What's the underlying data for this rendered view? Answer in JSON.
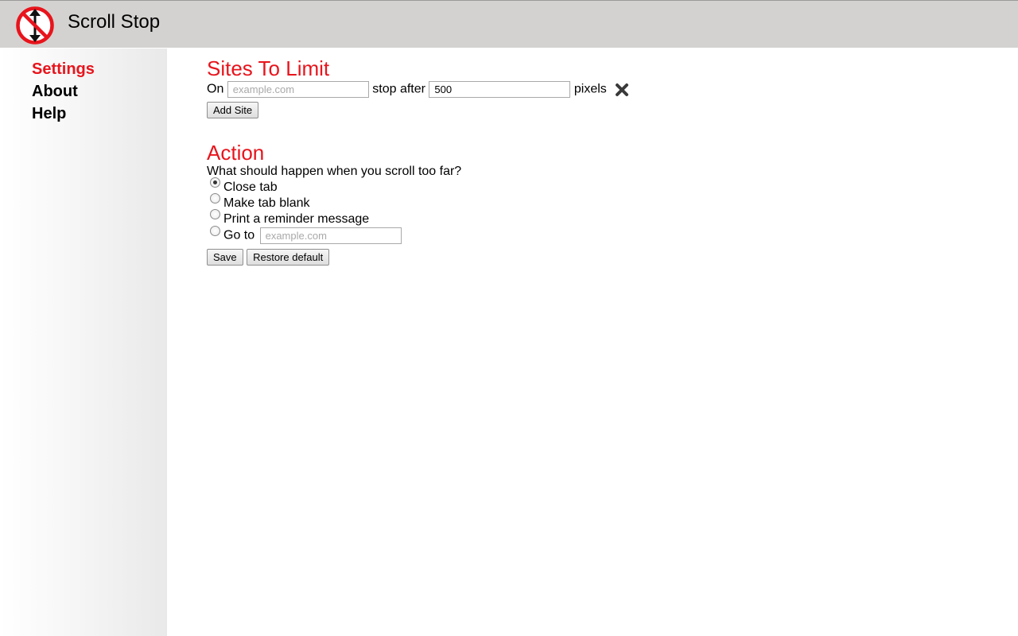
{
  "app": {
    "title": "Scroll Stop",
    "logo_icon": "no-scroll-icon",
    "accent_color": "#e8141c"
  },
  "sidebar": {
    "items": [
      {
        "label": "Settings",
        "active": true
      },
      {
        "label": "About",
        "active": false
      },
      {
        "label": "Help",
        "active": false
      }
    ]
  },
  "sites_section": {
    "title": "Sites To Limit",
    "on_label": "On",
    "site_placeholder": "example.com",
    "site_value": "",
    "stop_after_label": "stop after",
    "pixels_value": "500",
    "pixels_label": "pixels",
    "remove_icon": "close-x-icon",
    "add_site_label": "Add Site"
  },
  "action_section": {
    "title": "Action",
    "question": "What should happen when you scroll too far?",
    "options": [
      {
        "label": "Close tab",
        "checked": true
      },
      {
        "label": "Make tab blank",
        "checked": false
      },
      {
        "label": "Print a reminder message",
        "checked": false
      },
      {
        "label": "Go to",
        "checked": false
      }
    ],
    "goto_placeholder": "example.com",
    "save_label": "Save",
    "restore_label": "Restore default"
  }
}
